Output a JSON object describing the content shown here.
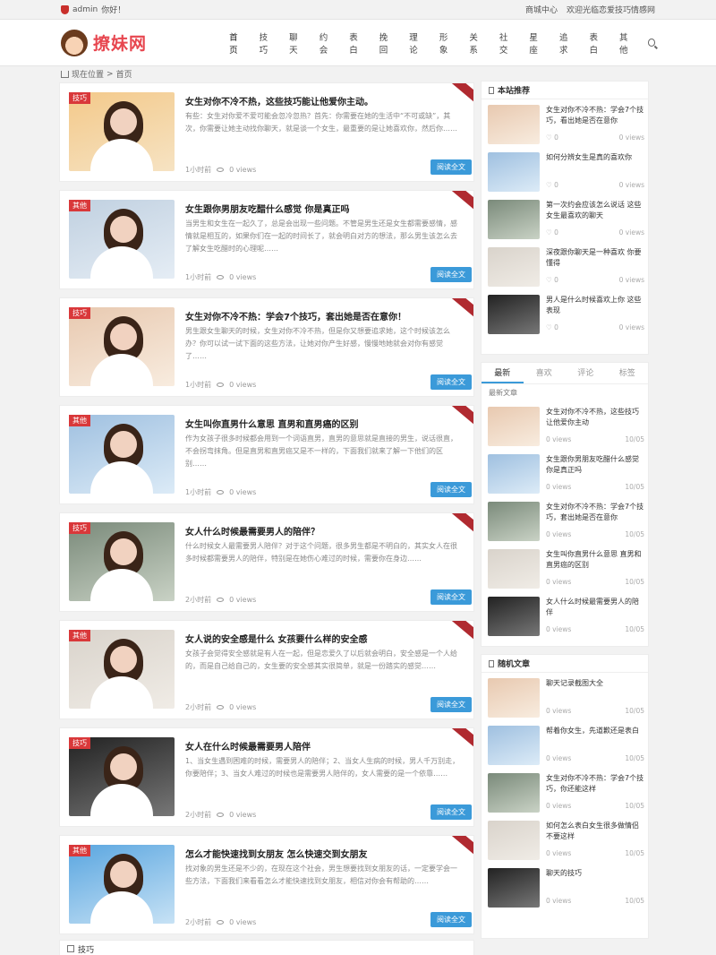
{
  "topbar": {
    "user": "admin",
    "greeting": "你好！",
    "links": [
      "商城中心",
      "欢迎光临恋爱技巧情感网"
    ]
  },
  "header": {
    "logo": "撩妹网",
    "nav": [
      "首页",
      "技巧",
      "聊天",
      "约会",
      "表白",
      "挽回",
      "理论",
      "形象",
      "关系",
      "社交",
      "星座",
      "追求",
      "表白",
      "其他"
    ]
  },
  "breadcrumb": {
    "label": "现在位置",
    "sep": ">",
    "current": "首页"
  },
  "posts": [
    {
      "tag": "技巧",
      "title": "女生对你不冷不热，这些技巧能让他爱你主动。",
      "excerpt": "有些：女生对你爱不爱可能会忽冷忽热？首先：你需要在她的生活中“不可或缺”，其次，你需要让她主动找你聊天，就是谈一个女生，最重要的是让她喜欢你，然后你……",
      "time": "1小时前",
      "views": "0 views",
      "btn": "阅读全文"
    },
    {
      "tag": "其他",
      "title": "女生跟你男朋友吃醋什么感觉 你是真正吗",
      "excerpt": "当男生和女生在一起久了，总是会出现一些问题。不管是男生还是女生都需要感情，感情就是相互的，如果你们在一起的时间长了，就会明白对方的想法，那么男生该怎么去了解女生吃醋时的心理呢……",
      "time": "1小时前",
      "views": "0 views",
      "btn": "阅读全文"
    },
    {
      "tag": "技巧",
      "title": "女生对你不冷不热：学会7个技巧，套出她是否在意你！",
      "excerpt": "男生跟女生聊天的时候，女生对你不冷不热，但是你又想要追求她，这个时候该怎么办？你可以试一试下面的这些方法，让她对你产生好感，慢慢地她就会对你有感觉了……",
      "time": "1小时前",
      "views": "0 views",
      "btn": "阅读全文"
    },
    {
      "tag": "其他",
      "title": "女生叫你直男什么意思 直男和直男癌的区别",
      "excerpt": "作为女孩子很多时候都会用到一个词语直男，直男的意思就是直接的男生，说话很直，不会拐弯抹角。但是直男和直男癌又是不一样的，下面我们就来了解一下他们的区别……",
      "time": "1小时前",
      "views": "0 views",
      "btn": "阅读全文"
    },
    {
      "tag": "技巧",
      "title": "女人什么时候最需要男人的陪伴？",
      "excerpt": "什么时候女人最需要男人陪伴？对于这个问题，很多男生都是不明白的，其实女人在很多时候都需要男人的陪伴，特别是在她伤心难过的时候，需要你在身边……",
      "time": "2小时前",
      "views": "0 views",
      "btn": "阅读全文"
    },
    {
      "tag": "其他",
      "title": "女人说的安全感是什么 女孩要什么样的安全感",
      "excerpt": "女孩子会觉得安全感就是有人在一起，但是恋爱久了以后就会明白，安全感是一个人给的，而是自己给自己的，女生要的安全感其实很简单，就是一份踏实的感觉……",
      "time": "2小时前",
      "views": "0 views",
      "btn": "阅读全文"
    },
    {
      "tag": "技巧",
      "title": "女人在什么时候最需要男人陪伴",
      "excerpt": "1、当女生遇到困难的时候，需要男人的陪伴；2、当女人生病的时候，男人千万别走，你要陪伴；3、当女人难过的时候也是需要男人陪伴的，女人需要的是一个依靠……",
      "time": "2小时前",
      "views": "0 views",
      "btn": "阅读全文"
    },
    {
      "tag": "其他",
      "title": "怎么才能快速找到女朋友 怎么快速交到女朋友",
      "excerpt": "找对象的男生还是不少的，在现在这个社会，男生想要找到女朋友的话，一定要学会一些方法，下面我们来看看怎么才能快速找到女朋友，相信对你会有帮助的……",
      "time": "2小时前",
      "views": "0 views",
      "btn": "阅读全文"
    }
  ],
  "sidebar": {
    "hot_title": "本站推荐",
    "hot": [
      {
        "title": "女生对你不冷不热：学会7个技巧，看出她是否在意你",
        "likes": "0",
        "views": "0 views"
      },
      {
        "title": "如何分辨女生是真的喜欢你",
        "likes": "0",
        "views": "0 views"
      },
      {
        "title": "第一次约会应该怎么说话 这些女生最喜欢的聊天",
        "likes": "0",
        "views": "0 views"
      },
      {
        "title": "深夜跟你聊天是一种喜欢 你要懂得",
        "likes": "0",
        "views": "0 views"
      },
      {
        "title": "男人是什么时候喜欢上你 这些表现",
        "likes": "0",
        "views": "0 views"
      }
    ],
    "tabs": [
      "最新",
      "喜欢",
      "评论",
      "标签"
    ],
    "latest_title": "最新文章",
    "latest": [
      {
        "title": "女生对你不冷不热，这些技巧让他爱你主动",
        "views": "0 views",
        "date": "10/05"
      },
      {
        "title": "女生跟你男朋友吃醋什么感觉 你是真正吗",
        "views": "0 views",
        "date": "10/05"
      },
      {
        "title": "女生对你不冷不热：学会7个技巧，套出她是否在意你",
        "views": "0 views",
        "date": "10/05"
      },
      {
        "title": "女生叫你直男什么意思 直男和直男癌的区别",
        "views": "0 views",
        "date": "10/05"
      },
      {
        "title": "女人什么时候最需要男人的陪伴",
        "views": "0 views",
        "date": "10/05"
      }
    ],
    "random_title": "随机文章",
    "random": [
      {
        "title": "聊天记录截图大全",
        "views": "0 views",
        "date": "10/05"
      },
      {
        "title": "帮着你女生，先道歉还是表白",
        "views": "0 views",
        "date": "10/05"
      },
      {
        "title": "女生对你不冷不热：学会7个技巧，你还能这样",
        "views": "0 views",
        "date": "10/05"
      },
      {
        "title": "如何怎么表白女生很多做情侣不要这样",
        "views": "0 views",
        "date": "10/05"
      },
      {
        "title": "聊天的技巧",
        "views": "0 views",
        "date": "10/05"
      }
    ]
  },
  "bottom_section": {
    "label": "技巧"
  },
  "colors": {
    "accent": "#3b9ad9",
    "tag": "#d9383a",
    "logo": "#e7464f"
  }
}
